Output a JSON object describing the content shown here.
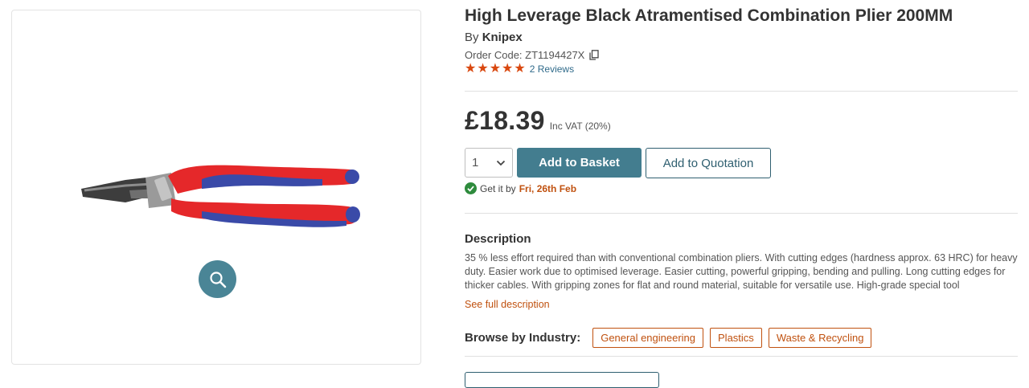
{
  "product": {
    "title": "High Leverage Black Atramentised Combination Plier 200MM",
    "by_prefix": "By",
    "brand": "Knipex",
    "order_code_label": "Order Code: ZT1194427X",
    "rating": 5,
    "reviews_label": "2 Reviews"
  },
  "pricing": {
    "price": "£18.39",
    "vat_label": "Inc VAT (20%)"
  },
  "purchase": {
    "quantity": "1",
    "add_to_basket_label": "Add to Basket",
    "add_to_quotation_label": "Add to Quotation",
    "delivery_prefix": "Get it by",
    "delivery_date": "Fri, 26th Feb"
  },
  "description": {
    "heading": "Description",
    "text": "35 % less effort required than with conventional combination pliers. With cutting edges (hardness approx. 63 HRC) for heavy duty. Easier work due to optimised leverage. Easier cutting, powerful gripping, bending and pulling. Long cutting edges for thicker cables. With gripping zones for flat and round material, suitable for versatile use. High-grade special tool",
    "see_full_label": "See full description"
  },
  "industry": {
    "label": "Browse by Industry:",
    "tags": [
      "General engineering",
      "Plastics",
      "Waste & Recycling"
    ]
  },
  "colors": {
    "accent": "#437d8f",
    "orange": "#c0510f",
    "star": "#d9480f",
    "handle_red": "#e5282a",
    "handle_blue": "#3a4aa8"
  },
  "icons": {
    "copy": "copy-icon",
    "zoom": "magnifier-icon",
    "check": "check-circle-icon",
    "dropdown": "chevron-down-icon"
  }
}
